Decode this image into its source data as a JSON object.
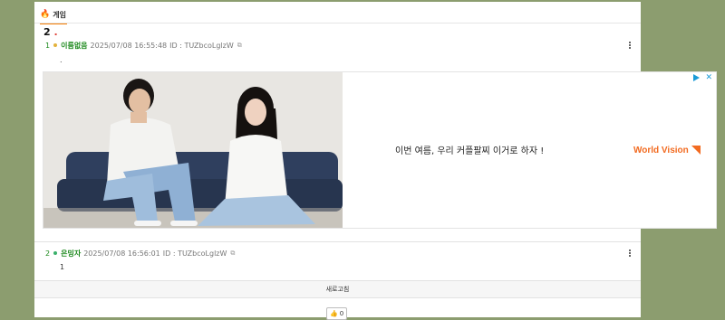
{
  "category": {
    "label": "게임"
  },
  "thread": {
    "number": "2",
    "dot": "."
  },
  "posts": [
    {
      "num": "1",
      "name": "이름없음",
      "datetime": "2025/07/08 16:55:48",
      "id_label": "ID : TUZbcoLglzW",
      "body": "."
    },
    {
      "num": "2",
      "name": "은밍자",
      "datetime": "2025/07/08 16:56:01",
      "id_label": "ID : TUZbcoLglzW",
      "body": "1"
    }
  ],
  "ad": {
    "text": "이번 여름, 우리 커플팔찌 이거로 하자 !",
    "brand": "World Vision"
  },
  "refresh": {
    "label": "새로고침"
  },
  "like": {
    "count": "0"
  },
  "colors": {
    "accent": "#f57c00",
    "name_green": "#1e8a1e",
    "brand": "#f26b21",
    "background": "#8c9d6f"
  }
}
